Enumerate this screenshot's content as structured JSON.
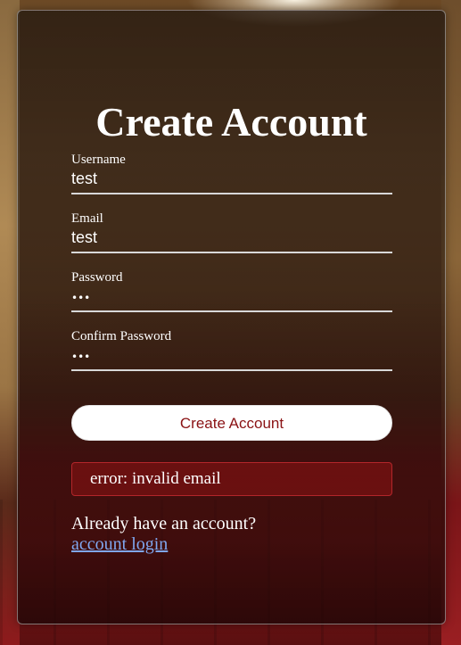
{
  "form": {
    "title": "Create Account",
    "fields": [
      {
        "label": "Username",
        "value": "test"
      },
      {
        "label": "Email",
        "value": "test"
      },
      {
        "label": "Password",
        "value": "•••"
      },
      {
        "label": "Confirm Password",
        "value": "•••"
      }
    ],
    "submit_label": "Create Account",
    "error_message": "error: invalid email",
    "login_prompt": "Already have an account?",
    "login_link_label": "account login"
  },
  "colors": {
    "button_text": "#8a1214",
    "error_border": "#b3262a",
    "link": "#7fa7f0"
  }
}
